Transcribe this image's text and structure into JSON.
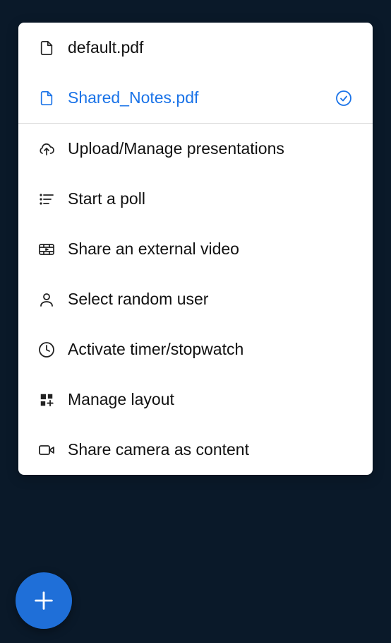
{
  "files": [
    {
      "label": "default.pdf",
      "selected": false
    },
    {
      "label": "Shared_Notes.pdf",
      "selected": true
    }
  ],
  "actions": {
    "upload": "Upload/Manage presentations",
    "poll": "Start a poll",
    "external_video": "Share an external video",
    "random_user": "Select random user",
    "timer": "Activate timer/stopwatch",
    "layout": "Manage layout",
    "share_camera": "Share camera as content"
  }
}
